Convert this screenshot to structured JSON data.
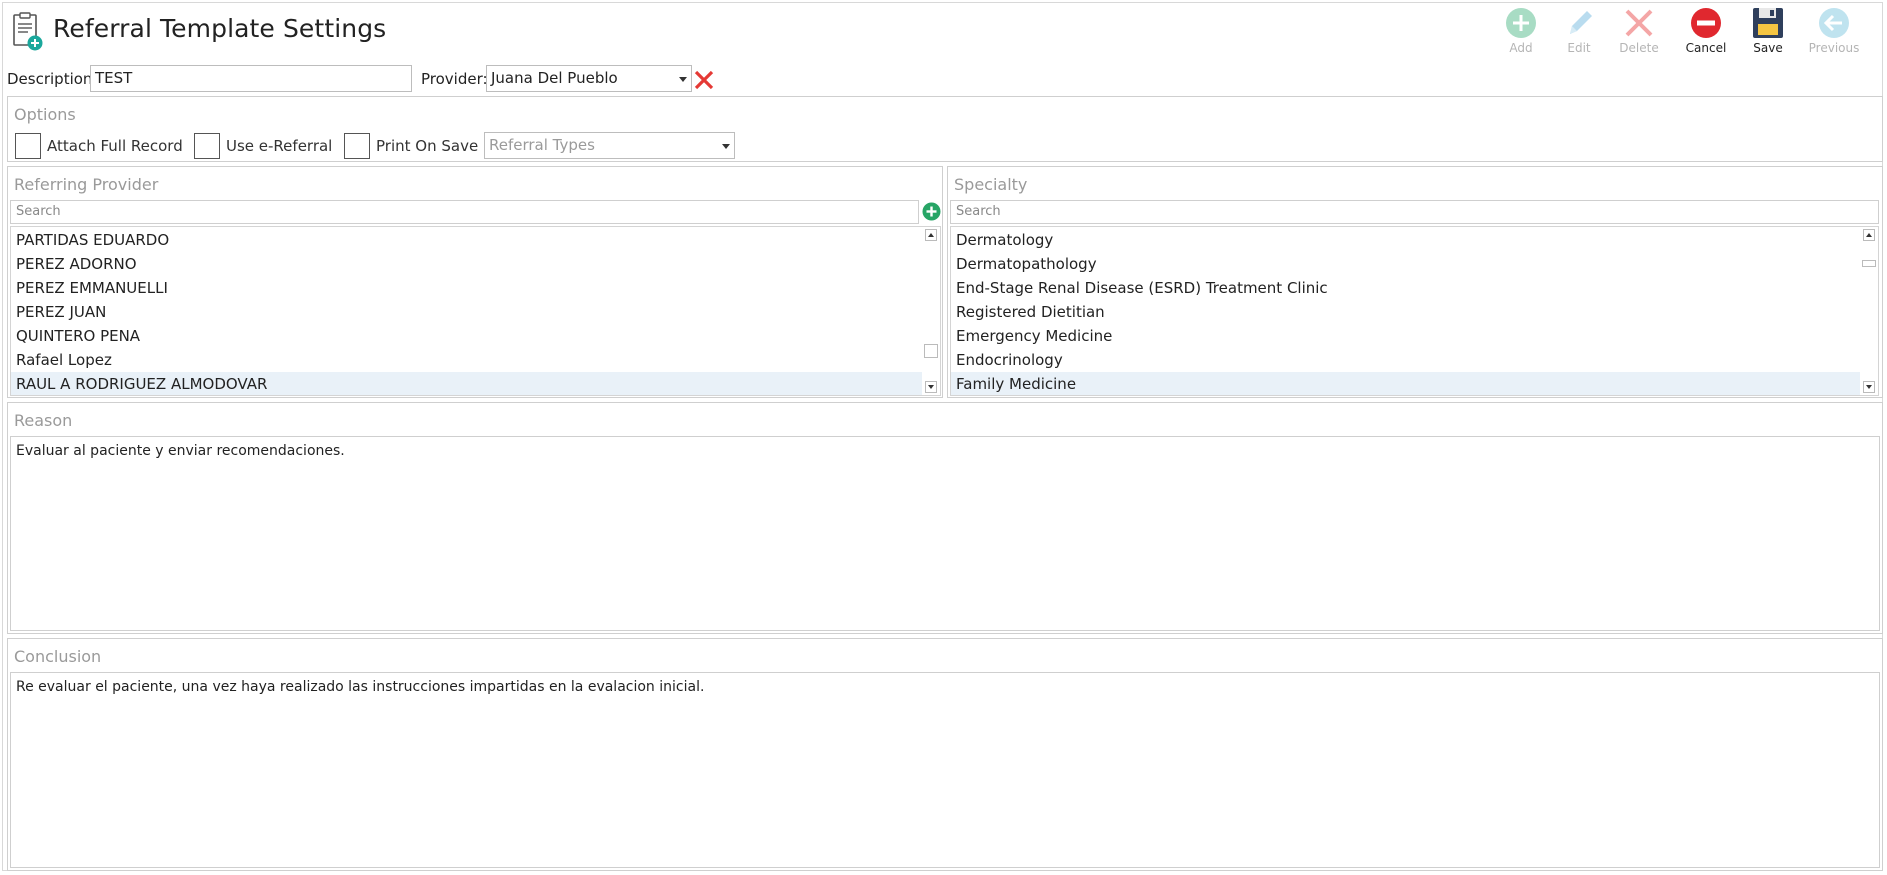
{
  "window": {
    "title": "Referral Template Settings"
  },
  "toolbar": {
    "add": "Add",
    "edit": "Edit",
    "delete": "Delete",
    "cancel": "Cancel",
    "save": "Save",
    "previous": "Previous"
  },
  "form": {
    "description_label": "Description:",
    "description_value": "TEST",
    "provider_label": "Provider:",
    "provider_value": "Juana Del Pueblo"
  },
  "options": {
    "title": "Options",
    "attach_full_record": "Attach Full Record",
    "use_e_referral": "Use e-Referral",
    "print_on_save": "Print On Save",
    "referral_types_placeholder": "Referral Types"
  },
  "referring_provider": {
    "title": "Referring Provider",
    "search_placeholder": "Search",
    "items": [
      "PARTIDAS EDUARDO",
      "PEREZ ADORNO",
      "PEREZ EMMANUELLI",
      "PEREZ JUAN",
      "QUINTERO PENA",
      "Rafael Lopez",
      "RAUL A RODRIGUEZ ALMODOVAR"
    ],
    "selected_index": 6
  },
  "specialty": {
    "title": "Specialty",
    "search_placeholder": "Search",
    "items": [
      "Dermatology",
      "Dermatopathology",
      "End-Stage Renal Disease (ESRD) Treatment Clinic",
      "Registered Dietitian",
      "Emergency Medicine",
      "Endocrinology",
      "Family Medicine"
    ],
    "selected_index": 6
  },
  "reason": {
    "title": "Reason",
    "text": "Evaluar al paciente y enviar recomendaciones."
  },
  "conclusion": {
    "title": "Conclusion",
    "text": "Re evaluar el paciente, una vez haya realizado las instrucciones impartidas en la evalacion inicial."
  },
  "colors": {
    "add_icon": "#a8dcc4",
    "edit_icon": "#b9dcef",
    "delete_icon": "#f4a6a6",
    "cancel_icon": "#e0282f",
    "save_icon": "#2f3f5c",
    "previous_icon": "#bfe3ef",
    "add_provider_icon": "#27a566",
    "clear_x_icon": "#e53935",
    "selection_bg": "#e9f1f8"
  },
  "icons": {
    "title": "clipboard-add-icon",
    "add": "plus-circle-icon",
    "edit": "pencil-icon",
    "delete": "x-icon",
    "cancel": "minus-circle-icon",
    "save": "floppy-disk-icon",
    "previous": "arrow-left-circle-icon",
    "provider_clear": "x-icon",
    "add_provider": "plus-circle-icon"
  }
}
